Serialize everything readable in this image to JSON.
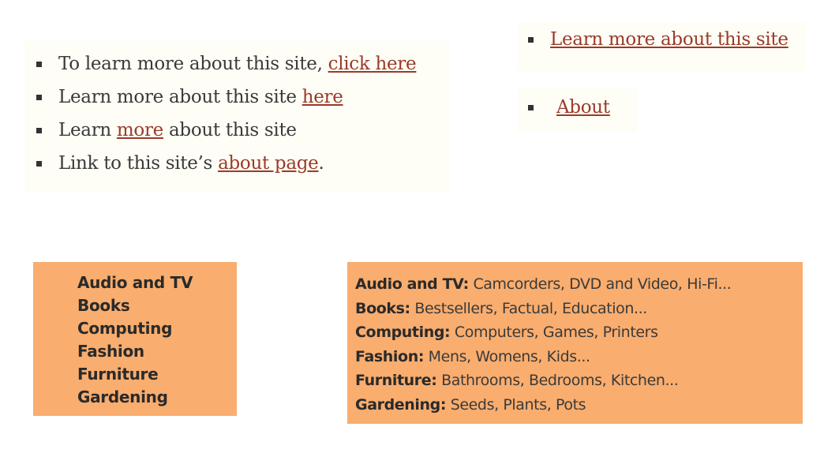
{
  "example_list": [
    {
      "before": "To learn more about this site, ",
      "link": "click here",
      "after": ""
    },
    {
      "before": "Learn more about this site ",
      "link": "here",
      "after": ""
    },
    {
      "before": "Learn ",
      "link": "more",
      "after": " about this site"
    },
    {
      "before": "Link to this site’s ",
      "link": "about page",
      "after": "."
    }
  ],
  "good_link_1": "Learn more about this site",
  "good_link_2": "About",
  "categories": [
    "Audio and TV",
    "Books",
    "Computing",
    "Fashion",
    "Furniture",
    "Gardening"
  ],
  "categories_detailed": [
    {
      "name": "Audio and TV:",
      "subs": "Camcorders, DVD and Video, Hi-Fi..."
    },
    {
      "name": "Books:",
      "subs": "Bestsellers, Factual, Education..."
    },
    {
      "name": "Computing:",
      "subs": "Computers, Games, Printers"
    },
    {
      "name": "Fashion:",
      "subs": "Mens, Womens, Kids..."
    },
    {
      "name": "Furniture:",
      "subs": "Bathrooms, Bedrooms, Kitchen..."
    },
    {
      "name": "Gardening:",
      "subs": "Seeds, Plants, Pots"
    }
  ]
}
